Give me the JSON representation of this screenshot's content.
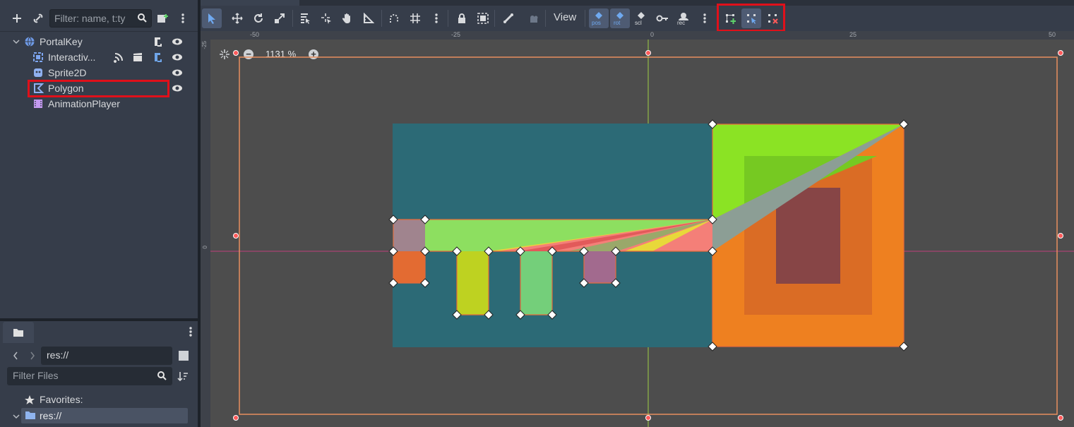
{
  "scene_panel": {
    "filter_placeholder": "Filter: name, t:ty",
    "nodes": [
      {
        "label": "PortalKey",
        "icon": "globe-icon"
      },
      {
        "label": "Interactiv...",
        "icon": "interactive-area-icon"
      },
      {
        "label": "Sprite2D",
        "icon": "sprite-icon"
      },
      {
        "label": "Polygon",
        "icon": "polygon-icon"
      },
      {
        "label": "AnimationPlayer",
        "icon": "animation-player-icon"
      }
    ]
  },
  "filesystem": {
    "path": "res://",
    "filter_placeholder": "Filter Files",
    "favorites_label": "Favorites:",
    "root_label": "res://"
  },
  "toolbar": {
    "view_label": "View",
    "anim_key_labels": [
      "pos",
      "rot",
      "scl",
      "rec"
    ],
    "polygon_tools": [
      "create-points",
      "edit-points",
      "delete-points"
    ]
  },
  "viewport": {
    "zoom": "1131 %",
    "ruler_h": [
      "-50",
      "-25",
      "0",
      "25",
      "50"
    ],
    "ruler_v": [
      "-25",
      "0"
    ]
  },
  "colors": {
    "selection_highlight": "#e0101a",
    "teal_rect": "#2c6a76",
    "orange_rect": "#ee8020",
    "green_tri": "#8be324"
  }
}
